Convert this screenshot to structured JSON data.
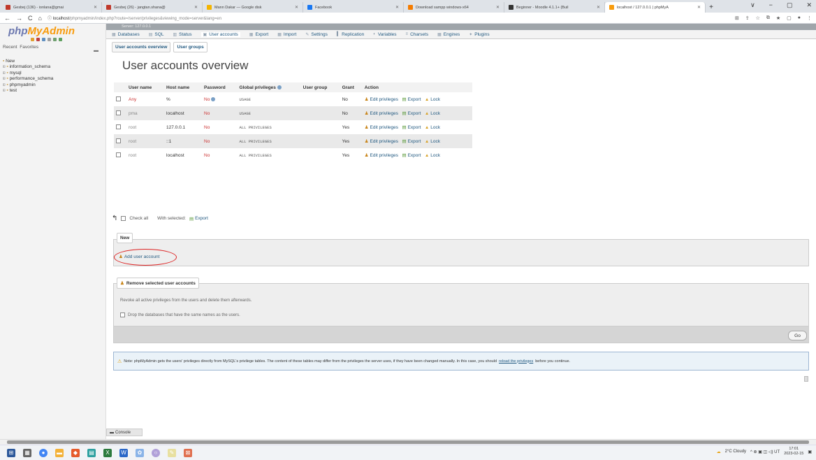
{
  "browser": {
    "tabs": [
      {
        "label": "Gesbej (136) - ionlana@gmai",
        "color": "#c0392b"
      },
      {
        "label": "Gesbej (26) - jangtan.shana@",
        "color": "#c0392b"
      },
      {
        "label": "Mann Dakar — Google disk",
        "color": "#f4b400"
      },
      {
        "label": "Facebook",
        "color": "#1877f2"
      },
      {
        "label": "Download sampp windows-x64",
        "color": "#f57c00"
      },
      {
        "label": "Beginner - Moodle 4.1.1+ (Buil",
        "color": "#333333"
      },
      {
        "label": "localhost / 127.0.0.1 | phpMyA",
        "color": "#f89c0e"
      }
    ],
    "new_tab": "+",
    "window_controls": [
      "∨",
      "−",
      "▢",
      "✕"
    ],
    "nav": {
      "back": "←",
      "forward": "→",
      "reload": "C",
      "home": "⌂"
    },
    "url_host": "localhost",
    "url_path": "/phpmyadmin/index.php?route=/server/privileges&viewing_mode=server&lang=en",
    "ext_icons": [
      "⊞",
      "⇪",
      "☆",
      "⧉",
      "★",
      "▢",
      "●",
      "⋮"
    ]
  },
  "sidebar": {
    "logo_a": "php",
    "logo_b": "MyAdmin",
    "recent": "Recent",
    "favorites": "Favorites",
    "collapse": "▬",
    "tree": [
      {
        "toggle": "",
        "label": "New"
      },
      {
        "toggle": "⊞",
        "label": "information_schema"
      },
      {
        "toggle": "⊞",
        "label": "mysql"
      },
      {
        "toggle": "⊞",
        "label": "performance_schema"
      },
      {
        "toggle": "⊞",
        "label": "phpmyadmin"
      },
      {
        "toggle": "⊞",
        "label": "test"
      }
    ]
  },
  "server_bar": "Server: 127.0.0.1",
  "top_menu": [
    {
      "icon": "▦",
      "label": "Databases"
    },
    {
      "icon": "▤",
      "label": "SQL"
    },
    {
      "icon": "▥",
      "label": "Status"
    },
    {
      "icon": "▣",
      "label": "User accounts"
    },
    {
      "icon": "▦",
      "label": "Export"
    },
    {
      "icon": "▦",
      "label": "Import"
    },
    {
      "icon": "✎",
      "label": "Settings"
    },
    {
      "icon": "▌",
      "label": "Replication"
    },
    {
      "icon": "◐",
      "label": "Variables"
    },
    {
      "icon": "≡",
      "label": "Charsets"
    },
    {
      "icon": "▦",
      "label": "Engines"
    },
    {
      "icon": "✦",
      "label": "Plugins"
    }
  ],
  "subtabs": [
    "User accounts overview",
    "User groups"
  ],
  "page_title": "User accounts overview",
  "table": {
    "headers": [
      "User name",
      "Host name",
      "Password",
      "Global privileges",
      "User group",
      "Grant",
      "Action"
    ],
    "rows": [
      {
        "user": "Any",
        "host": "%",
        "password": "No",
        "privileges": "USAGE",
        "group": "",
        "grant": "No"
      },
      {
        "user": "pma",
        "host": "localhost",
        "password": "No",
        "privileges": "USAGE",
        "group": "",
        "grant": "No"
      },
      {
        "user": "root",
        "host": "127.0.0.1",
        "password": "No",
        "privileges": "ALL PRIVILEGES",
        "group": "",
        "grant": "Yes"
      },
      {
        "user": "root",
        "host": "::1",
        "password": "No",
        "privileges": "ALL PRIVILEGES",
        "group": "",
        "grant": "Yes"
      },
      {
        "user": "root",
        "host": "localhost",
        "password": "No",
        "privileges": "ALL PRIVILEGES",
        "group": "",
        "grant": "Yes"
      }
    ],
    "action_edit": "Edit privileges",
    "action_export": "Export",
    "action_lock": "Lock"
  },
  "bulk": {
    "check_all": "Check all",
    "with_selected": "With selected:",
    "export": "Export"
  },
  "new_section": {
    "legend": "New",
    "add_user": "Add user account"
  },
  "remove_section": {
    "legend": "Remove selected user accounts",
    "description": "Revoke all active privileges from the users and delete them afterwards.",
    "drop_label": "Drop the databases that have the same names as the users.",
    "go": "Go"
  },
  "note": {
    "text": "Note: phpMyAdmin gets the users' privileges directly from MySQL's privilege tables. The content of these tables may differ from the privileges the server uses, if they have been changed manually. In this case, you should",
    "link": "reload the privileges",
    "tail": "before you continue."
  },
  "console": "Console",
  "taskbar": {
    "weather": "2°C Cloudy",
    "tray": "^ ⊕ ▣ ◫ ◁) UT",
    "time": "17:01",
    "date": "2023-02-15"
  },
  "colors": {
    "link": "#235a81",
    "red": "#cc3333",
    "circle": "#dd2222"
  }
}
